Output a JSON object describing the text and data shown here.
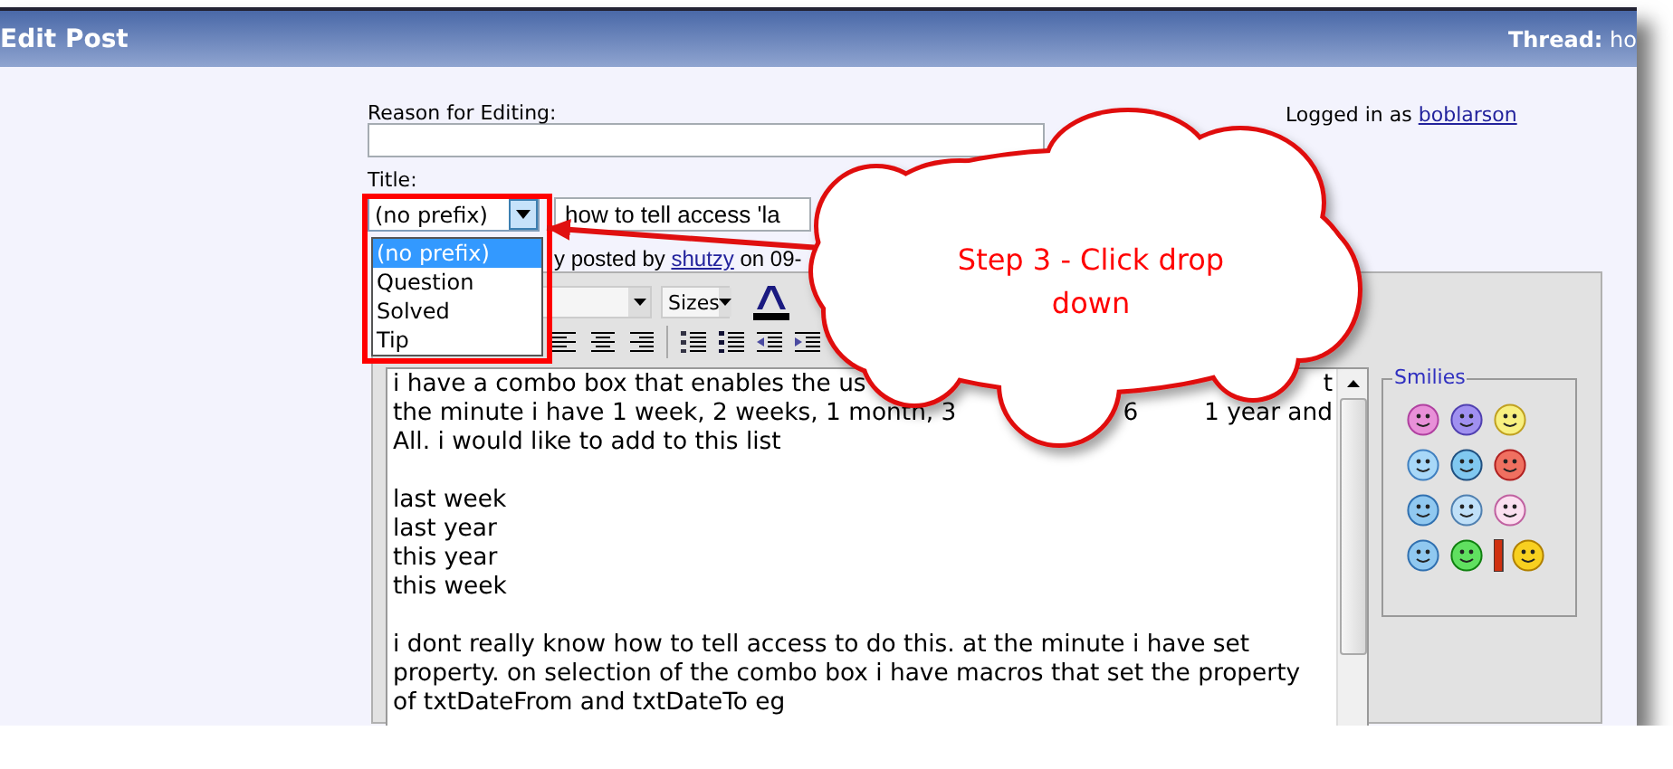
{
  "header": {
    "title": "Edit Post",
    "thread_label": "Thread:",
    "thread_value": "ho"
  },
  "reason": {
    "label": "Reason for Editing:"
  },
  "login": {
    "text": "Logged in as",
    "user": "boblarson"
  },
  "title_field": {
    "label": "Title:",
    "prefix": "(no prefix)",
    "value": "how to tell access 'la",
    "expanded": true
  },
  "prefix_options": [
    {
      "label": "(no prefix)",
      "selected": true
    },
    {
      "label": "Question",
      "selected": false
    },
    {
      "label": "Solved",
      "selected": false
    },
    {
      "label": "Tip",
      "selected": false
    }
  ],
  "posted": {
    "before": "y posted by",
    "user": "shutzy",
    "after": "on 09-"
  },
  "toolbar": {
    "size_select": "Sizes"
  },
  "message": [
    [
      [
        "i have a combo box that enables the us",
        "t"
      ],
      [
        "the minute i have 1 week, 2 weeks, 1 month, 3",
        "6",
        "1 year and"
      ],
      [
        "All. i would like to add to this list"
      ]
    ],
    [
      [
        "last week"
      ],
      [
        "last year"
      ],
      [
        "this year"
      ],
      [
        "this week"
      ]
    ],
    [
      [
        "i dont really know how to tell access to do this. at the minute i have set"
      ],
      [
        "property. on selection of the combo box i have macros that set the property"
      ],
      [
        "of txtDateFrom and txtDateTo eg"
      ]
    ]
  ],
  "smilies": {
    "legend": "Smilies"
  },
  "callout": {
    "text": "Step 3 - Click drop down"
  }
}
